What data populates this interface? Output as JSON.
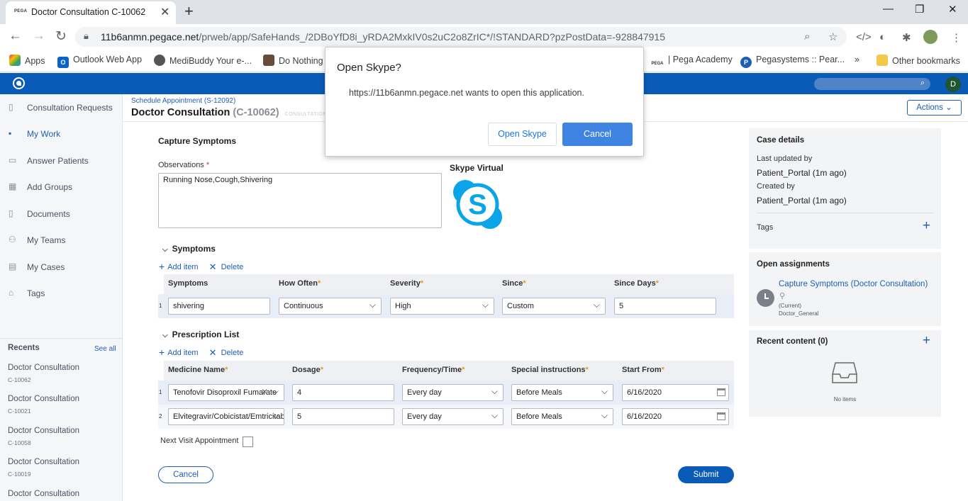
{
  "browser": {
    "tab_favicon": "PEGA",
    "tab_title": "Doctor Consultation C-10062",
    "url_host": "11b6anmn.pegace.net",
    "url_path": "/prweb/app/SafeHands_/2DBoYfD8i_yRDA2MxkIV0s2uC2o8ZrIC*/!STANDARD?pzPostData=-928847915",
    "bookmarks": [
      {
        "label": "Apps",
        "icon": "apps-grid-icon"
      },
      {
        "label": "Outlook Web App",
        "icon": "outlook-icon"
      },
      {
        "label": "MediBuddy Your e-...",
        "icon": "globe-icon"
      },
      {
        "label": "Do Nothing",
        "icon": "image-icon"
      },
      {
        "label": "| Pega Academy",
        "icon": "pega-icon"
      },
      {
        "label": "Pegasystems :: Pear...",
        "icon": "pega-p-icon"
      },
      {
        "label": "»",
        "icon": ""
      },
      {
        "label": "Other bookmarks",
        "icon": "folder-icon"
      }
    ]
  },
  "app": {
    "avatar_initial": "D"
  },
  "sidebar": {
    "items": [
      {
        "label": "Consultation Requests",
        "icon": "clipboard-icon"
      },
      {
        "label": "My Work",
        "icon": "flag-icon"
      },
      {
        "label": "Answer Patients",
        "icon": "chat-icon"
      },
      {
        "label": "Add Groups",
        "icon": "grid-icon"
      },
      {
        "label": "Documents",
        "icon": "document-icon"
      },
      {
        "label": "My Teams",
        "icon": "people-icon"
      },
      {
        "label": "My Cases",
        "icon": "briefcase-icon"
      },
      {
        "label": "Tags",
        "icon": "tag-icon"
      }
    ],
    "recents_title": "Recents",
    "see_all": "See all",
    "recents": [
      {
        "title": "Doctor Consultation",
        "id": "C-10062"
      },
      {
        "title": "Doctor Consultation",
        "id": "C-10021"
      },
      {
        "title": "Doctor Consultation",
        "id": "C-10058"
      },
      {
        "title": "Doctor Consultation",
        "id": "C-10019"
      },
      {
        "title": "Doctor Consultation",
        "id": ""
      }
    ]
  },
  "case": {
    "parent": "Schedule Appointment (S-12092)",
    "title": "Doctor Consultation",
    "id": "(C-10062)",
    "status": "CONSULTATION",
    "actions_label": "Actions"
  },
  "form": {
    "section_title": "Capture Symptoms",
    "observations_label": "Observations",
    "observations_value": "Running Nose,Cough,Shivering",
    "skype_label": "Skype Virtual",
    "add_item": "Add item",
    "delete": "Delete",
    "symptoms": {
      "title": "Symptoms",
      "headers": [
        "Symptoms",
        "How Often",
        "Severity",
        "Since",
        "Since Days"
      ],
      "rows": [
        {
          "num": "1",
          "symptom": "shivering",
          "how_often": "Continuous",
          "severity": "High",
          "since": "Custom",
          "since_days": "5"
        }
      ]
    },
    "prescriptions": {
      "title": "Prescription List",
      "headers": [
        "Medicine Name",
        "Dosage",
        "Frequency/Time",
        "Special instructions",
        "Start From"
      ],
      "rows": [
        {
          "num": "1",
          "medicine": "Tenofovir Disoproxil Fumarate",
          "dosage": "4",
          "frequency": "Every day",
          "instructions": "Before Meals",
          "start": "6/16/2020"
        },
        {
          "num": "2",
          "medicine": "Elvitegravir/Cobicistat/Emtricitabine",
          "dosage": "5",
          "frequency": "Every day",
          "instructions": "Before Meals",
          "start": "6/16/2020"
        }
      ]
    },
    "next_visit_label": "Next Visit Appointment",
    "cancel_label": "Cancel",
    "submit_label": "Submit"
  },
  "case_details": {
    "title": "Case details",
    "last_updated_label": "Last updated by",
    "last_updated_value": "Patient_Portal (1m ago)",
    "created_label": "Created by",
    "created_value": "Patient_Portal (1m ago)",
    "tags_label": "Tags"
  },
  "assignments": {
    "title": "Open assignments",
    "link": "Capture Symptoms (Doctor Consultation)",
    "current": "(Current)",
    "assignee": "Doctor_General"
  },
  "recent_content": {
    "title": "Recent content (0)",
    "empty": "No items"
  },
  "dialog": {
    "title": "Open Skype?",
    "message": "https://11b6anmn.pegace.net wants to open this application.",
    "open_label": "Open Skype",
    "cancel_label": "Cancel"
  },
  "colors": {
    "pega_blue": "#0a5bb8",
    "link_blue": "#1e5fb4",
    "skype_blue": "#0aa5e8"
  }
}
